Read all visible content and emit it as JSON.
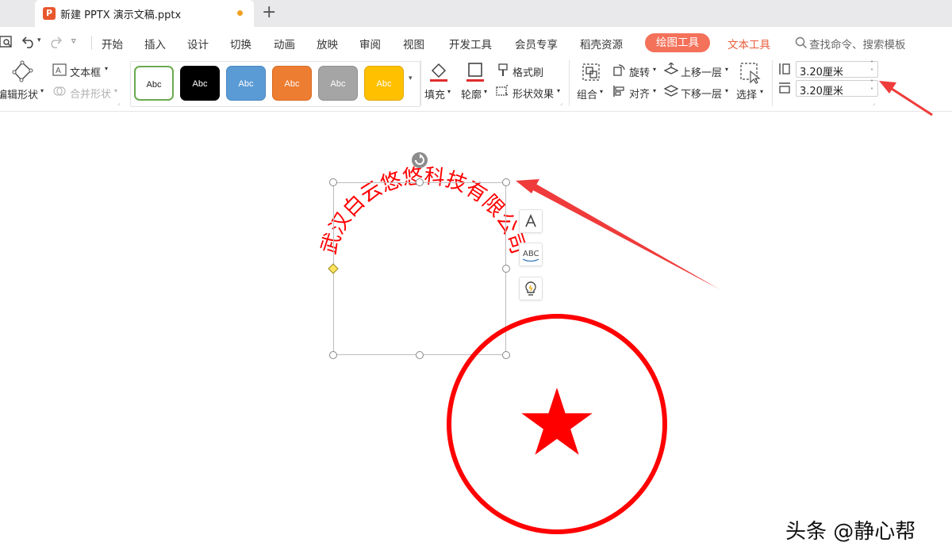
{
  "tab": {
    "title": "新建 PPTX 演示文稿.pptx",
    "file_icon": "P"
  },
  "menu": {
    "items": [
      "开始",
      "插入",
      "设计",
      "切换",
      "动画",
      "放映",
      "审阅",
      "视图",
      "开发工具",
      "会员专享",
      "稻壳资源"
    ],
    "active_tab": "绘图工具",
    "text_tool": "文本工具",
    "search_placeholder": "查找命令、搜索模板"
  },
  "ribbon": {
    "edit_shape": "编辑形状",
    "text_box": "文本框",
    "merge_shape": "合并形状",
    "styles": [
      {
        "label": "Abc",
        "bg": "#ffffff",
        "fg": "#222222",
        "border": "#6aab4f"
      },
      {
        "label": "Abc",
        "bg": "#000000",
        "fg": "#ffffff",
        "border": "#000000"
      },
      {
        "label": "Abc",
        "bg": "#5b9bd5",
        "fg": "#ffffff",
        "border": "#4a88c0"
      },
      {
        "label": "Abc",
        "bg": "#ed7d31",
        "fg": "#ffffff",
        "border": "#d86a22"
      },
      {
        "label": "Abc",
        "bg": "#a5a5a5",
        "fg": "#ffffff",
        "border": "#8f8f8f"
      },
      {
        "label": "Abc",
        "bg": "#ffc000",
        "fg": "#ffffff",
        "border": "#e0a800"
      }
    ],
    "fill": "填充",
    "outline": "轮廓",
    "format_painter": "格式刷",
    "shape_effects": "形状效果",
    "group": "组合",
    "rotate": "旋转",
    "align": "对齐",
    "bring_forward": "上移一层",
    "send_backward": "下移一层",
    "select": "选择",
    "height": "3.20厘米",
    "width": "3.20厘米"
  },
  "canvas": {
    "arc_text": "武汉白云悠悠科技有限公司",
    "seal_color": "#ff0000",
    "annotation_color": "#ef3b3b"
  },
  "watermark": "头条 @静心帮"
}
